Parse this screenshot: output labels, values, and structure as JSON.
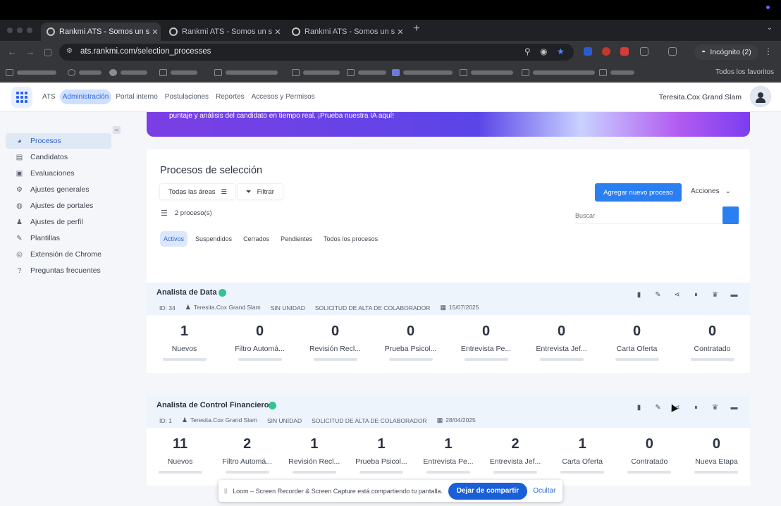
{
  "browser": {
    "tabs": [
      {
        "title": "Rankmi ATS - Somos un soft",
        "close": "✕"
      },
      {
        "title": "Rankmi ATS - Somos un soft",
        "close": "✕"
      },
      {
        "title": "Rankmi ATS - Somos un soft",
        "close": "✕"
      }
    ],
    "new_tab": "+",
    "url": "ats.rankmi.com/selection_processes",
    "incognito_label": "Incógnito (2)",
    "all_bookmarks": "Todos los favoritos",
    "colors": {
      "accent": "#2b7ff0",
      "star": "#4a8cff"
    }
  },
  "app": {
    "nav": [
      {
        "label": "ATS",
        "active": false
      },
      {
        "label": "Administración",
        "active": true
      },
      {
        "label": "Portal interno",
        "active": false
      },
      {
        "label": "Postulaciones",
        "active": false
      },
      {
        "label": "Reportes",
        "active": false
      },
      {
        "label": "Accesos y Permisos",
        "active": false
      }
    ],
    "user_name": "Teresita.Cox Grand Slam",
    "sidebar": [
      {
        "label": "Procesos",
        "icon": "pie-chart-icon",
        "glyph": "◕"
      },
      {
        "label": "Candidatos",
        "icon": "candidates-icon",
        "glyph": "▤"
      },
      {
        "label": "Evaluaciones",
        "icon": "clipboard-check-icon",
        "glyph": "▣"
      },
      {
        "label": "Ajustes generales",
        "icon": "gear-icon",
        "glyph": "⚙"
      },
      {
        "label": "Ajustes de portales",
        "icon": "globe-icon",
        "glyph": "◍"
      },
      {
        "label": "Ajustes de perfil",
        "icon": "user-icon",
        "glyph": "♟"
      },
      {
        "label": "Plantillas",
        "icon": "edit-template-icon",
        "glyph": "✎"
      },
      {
        "label": "Extensión de Chrome",
        "icon": "chrome-icon",
        "glyph": "◎"
      },
      {
        "label": "Preguntas frecuentes",
        "icon": "question-icon",
        "glyph": "?"
      }
    ],
    "banner_text": "puntaje y análisis del candidato en tiempo real. ¡Prueba nuestra IA aquí!",
    "list": {
      "title": "Procesos de selección",
      "all_areas": "Todas las áreas",
      "filter": "Filtrar",
      "add_process": "Agregar nuevo proceso",
      "actions": "Acciones",
      "count": "2 proceso(s)",
      "search_placeholder": "Buscar",
      "tabs": [
        {
          "label": "Activos",
          "active": true
        },
        {
          "label": "Suspendidos",
          "active": false
        },
        {
          "label": "Cerrados",
          "active": false
        },
        {
          "label": "Pendientes",
          "active": false
        },
        {
          "label": "Todos los procesos",
          "active": false
        }
      ]
    },
    "processes": [
      {
        "title": "Analista de Data",
        "id": "ID: 34",
        "owner": "Teresita.Cox Grand Slam",
        "unit": "SIN UNIDAD",
        "request": "SOLICITUD DE ALTA DE COLABORADOR",
        "date": "15/07/2025",
        "stages": [
          {
            "count": "1",
            "label": "Nuevos"
          },
          {
            "count": "0",
            "label": "Filtro Automá..."
          },
          {
            "count": "0",
            "label": "Revisión Recl..."
          },
          {
            "count": "0",
            "label": "Prueba Psicol..."
          },
          {
            "count": "0",
            "label": "Entrevista Pe..."
          },
          {
            "count": "0",
            "label": "Entrevista Jef..."
          },
          {
            "count": "0",
            "label": "Carta Oferta"
          },
          {
            "count": "0",
            "label": "Contratado"
          }
        ]
      },
      {
        "title": "Analista de Control Financiero",
        "id": "ID: 1",
        "owner": "Teresita.Cox Grand Slam",
        "unit": "SIN UNIDAD",
        "request": "SOLICITUD DE ALTA DE COLABORADOR",
        "date": "28/04/2025",
        "stages": [
          {
            "count": "11",
            "label": "Nuevos"
          },
          {
            "count": "2",
            "label": "Filtro Automá..."
          },
          {
            "count": "1",
            "label": "Revisión Recl..."
          },
          {
            "count": "1",
            "label": "Prueba Psicol..."
          },
          {
            "count": "1",
            "label": "Entrevista Pe..."
          },
          {
            "count": "2",
            "label": "Entrevista Jef..."
          },
          {
            "count": "1",
            "label": "Carta Oferta"
          },
          {
            "count": "0",
            "label": "Contratado"
          },
          {
            "count": "0",
            "label": "Nueva Etapa"
          }
        ]
      }
    ]
  },
  "loom": {
    "message": "Loom – Screen Recorder & Screen Capture está compartiendo tu pantalla.",
    "stop": "Dejar de compartir",
    "hide": "Ocultar"
  }
}
